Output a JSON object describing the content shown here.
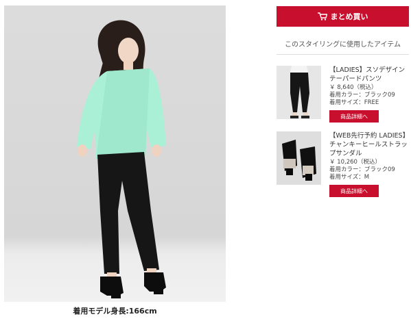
{
  "styling": {
    "caption": "着用モデル身長:166cm"
  },
  "sidebar": {
    "cart_button_label": "まとめ買い",
    "section_title": "このスタイリングに使用したアイテム",
    "products": [
      {
        "name": "【LADIES】スソデザインテーパードパンツ",
        "price": "￥ 8,640（税込）",
        "color": "着用カラー：ブラック09",
        "size": "着用サイズ：FREE",
        "detail_label": "商品詳細へ"
      },
      {
        "name": "【WEB先行予約 LADIES】チャンキーヒールストラップサンダル",
        "price": "￥ 10,260（税込）",
        "color": "着用カラー：ブラック09",
        "size": "着用サイズ：M",
        "detail_label": "商品詳細へ"
      }
    ]
  },
  "colors": {
    "accent": "#c8102e",
    "top": "#a9f0d6",
    "pants": "#161616"
  },
  "icons": [
    "cart-icon"
  ]
}
